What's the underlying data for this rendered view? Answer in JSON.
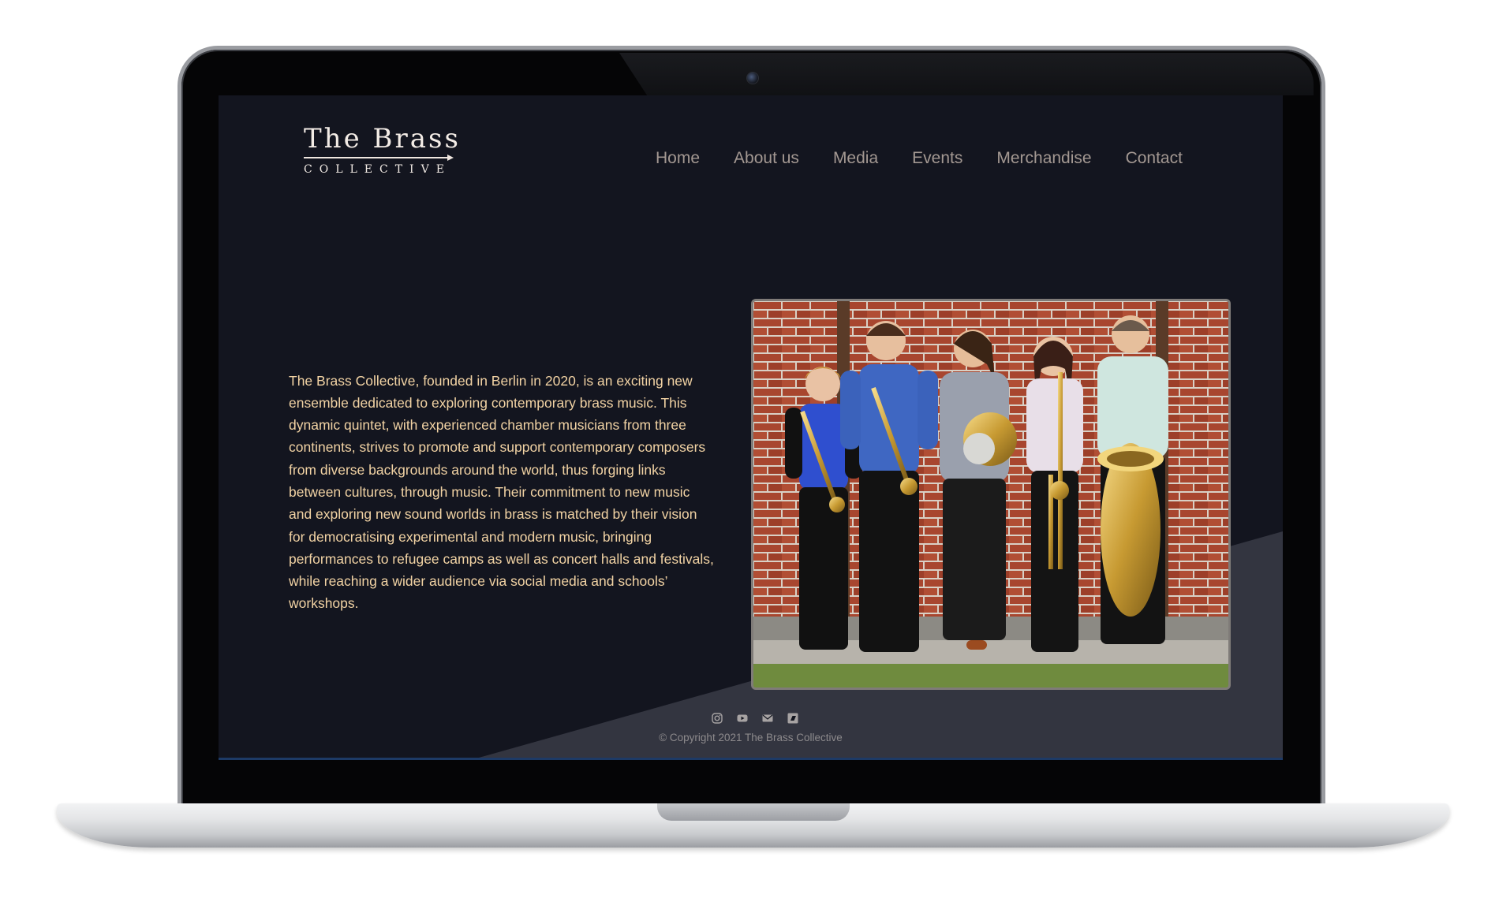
{
  "site": {
    "logo": {
      "title": "The Brass",
      "subtitle": "COLLECTIVE"
    },
    "nav": [
      {
        "label": "Home"
      },
      {
        "label": "About us"
      },
      {
        "label": "Media"
      },
      {
        "label": "Events"
      },
      {
        "label": "Merchandise"
      },
      {
        "label": "Contact"
      }
    ],
    "intro": "The Brass Collective, founded in Berlin in 2020, is an exciting new ensemble dedicated to exploring contemporary brass music. This dynamic quintet, with experienced chamber musicians from three continents, strives to promote and support contemporary composers from diverse backgrounds around the world, thus forging links between cultures, through music. Their commitment to new music and exploring new sound worlds in brass is matched by their vision for democratising experimental and modern music, bringing performances to refugee camps as well as concert halls and festivals, while reaching a wider audience via social media and schools’ workshops.",
    "photo": {
      "icon": "group-photo"
    },
    "footer": {
      "social_icons": [
        "instagram-icon",
        "youtube-icon",
        "email-icon",
        "bandcamp-icon"
      ],
      "copyright": "© Copyright 2021 The Brass Collective"
    }
  },
  "colors": {
    "background": "#13151f",
    "diagonal_panel": "#333540",
    "nav_text": "#a39892",
    "body_text": "#f2d3a4",
    "logo_text": "#f3ece6"
  }
}
